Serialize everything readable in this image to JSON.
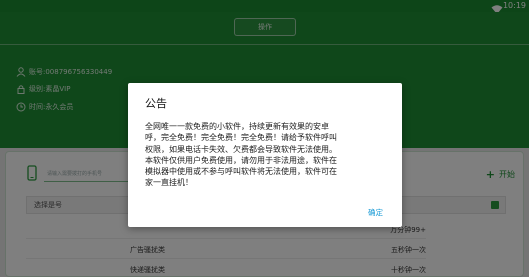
{
  "status_bar": {
    "time": "10:19",
    "wifi_icon": "wifi-icon"
  },
  "header": {
    "top_button_label": "操作",
    "account_label": "账号:008796756330449",
    "level_label": "级别:素晶VIP",
    "time_label": "时间:永久会员"
  },
  "main": {
    "phone_placeholder": "请输入需要拨打的手机号",
    "start_label": "开始",
    "select_label": "选择是号",
    "rows": [
      {
        "label": "",
        "value": "万分钟99+"
      },
      {
        "label": "广告骚扰类",
        "value": "五秒钟一次"
      },
      {
        "label": "快递骚扰类",
        "value": "十秒钟一次"
      }
    ]
  },
  "dialog": {
    "title": "公告",
    "body": "全网唯一一款免费的小软件，持续更新有效果的安卓\n呼，完全免费！完全免费！完全免费！请给予软件呼叫\n权限，如果电话卡失效、欠费都会导致软件无法使用。\n本软件仅供用户免费使用，请勿用于非法用途，软件在\n模拟器中使用或不参与呼叫软件将无法使用，软件可在\n家一直挂机！",
    "confirm_label": "确定"
  },
  "colors": {
    "brand_green": "#1f8f35",
    "link_blue": "#1a9bd6"
  }
}
